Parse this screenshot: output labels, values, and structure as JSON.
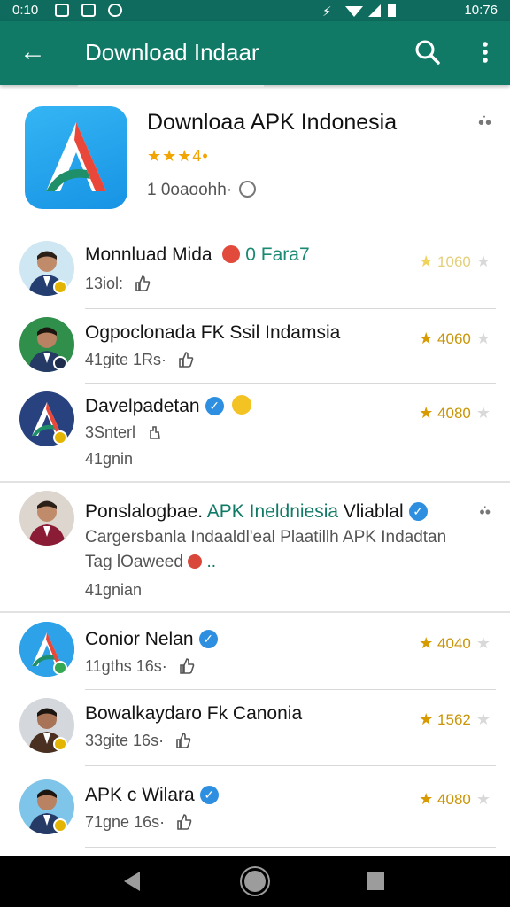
{
  "status_bar": {
    "time_left": "0:10",
    "time_right": "10:76"
  },
  "app_bar": {
    "title": "Download Indaar",
    "back_label": "←"
  },
  "featured": {
    "app_name": "Downloaa APK Indonesia",
    "stars": "★★★4•",
    "downloads": "1 0oaoohh·",
    "more": "•̇•"
  },
  "items": [
    {
      "name": "Monnluad Mida",
      "extra": "0 Fara7",
      "meta": "13iol: ",
      "rating": "1060"
    },
    {
      "name": "Ogpoclonada FK Ssil Indamsia",
      "meta": "41gite 1Rs·",
      "rating": "4060"
    },
    {
      "name": "Davelpadetan",
      "meta": "3Snterl",
      "meta2": "41gnin",
      "rating": "4080"
    },
    {
      "name": "Ponslalogbae.",
      "name_accent": "APK Ineldniesia",
      "name_tail": "Vliablal",
      "desc": "Cargersbanla Indaaldl'eal Plaatillh APK Indadtan",
      "desc2": "Tag lOaweed",
      "meta": "41gnian"
    },
    {
      "name": "Conior Nelan",
      "meta": "11gths 16s·",
      "rating": "4040"
    },
    {
      "name": "Bowalkaydaro Fk Canonia",
      "meta": "33gite 16s·",
      "rating": "1562"
    },
    {
      "name": "APK c Wilara",
      "meta": "71gne 16s·",
      "rating": "4080"
    }
  ],
  "colors": {
    "app_bar": "#117a66",
    "status_bar": "#0f6b5d",
    "star": "#d79a00",
    "verified": "#2e8fe0"
  }
}
